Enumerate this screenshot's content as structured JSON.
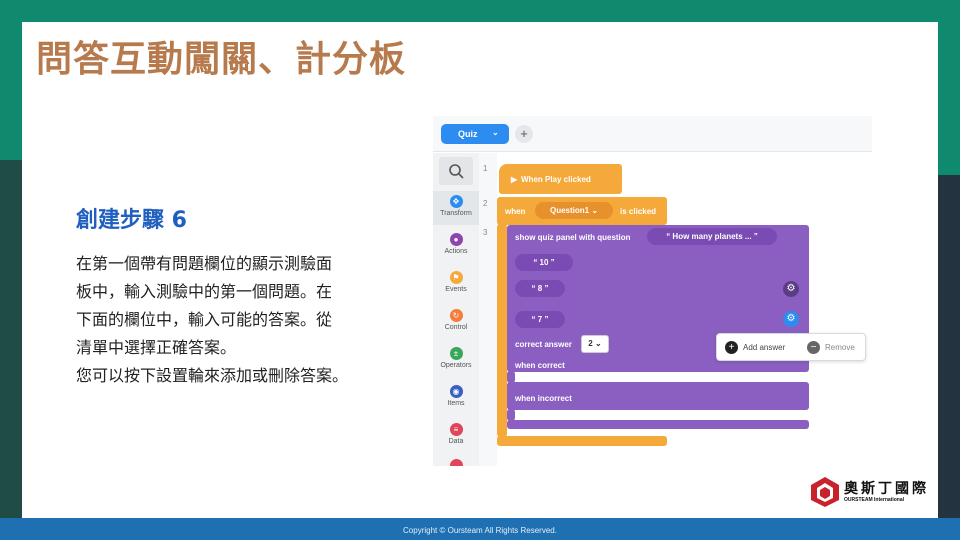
{
  "slide": {
    "title": "問答互動闖關、計分板",
    "step_title": "創建步驟 6",
    "description_lines": [
      "在第一個帶有問題欄位的顯示測驗面",
      "板中，輸入測驗中的第一個問題。在",
      "下面的欄位中，輸入可能的答案。從",
      "清單中選擇正確答案。",
      "您可以按下設置輪來添加或刪除答案。"
    ],
    "footer": "Copyright © Oursteam All Rights Reserved.",
    "logo": {
      "chinese": "奧斯丁國際",
      "english": "OURSTEAM International"
    }
  },
  "colors": {
    "accent_green": "#0f8a6e",
    "title_brown": "#b67a4d",
    "step_blue": "#1f5fbf",
    "footer_blue": "#1f6fb3",
    "block_orange": "#f5a93a",
    "block_purple": "#8b5fc2",
    "tab_blue": "#2d8cf0"
  },
  "editor": {
    "tab_label": "Quiz",
    "add_tab_symbol": "+",
    "palette": [
      {
        "label": "Transform",
        "icon": "transform-icon",
        "color": "#2d8cf0"
      },
      {
        "label": "Actions",
        "icon": "eye-icon",
        "color": "#8e44ad"
      },
      {
        "label": "Events",
        "icon": "flag-icon",
        "color": "#f5a93a"
      },
      {
        "label": "Control",
        "icon": "control-icon",
        "color": "#f57c3a"
      },
      {
        "label": "Operators",
        "icon": "operators-icon",
        "color": "#3aa65a"
      },
      {
        "label": "Items",
        "icon": "items-icon",
        "color": "#3a5fc2"
      },
      {
        "label": "Data",
        "icon": "data-icon",
        "color": "#e0455a"
      }
    ],
    "line_numbers": [
      "1",
      "2",
      "3"
    ],
    "blocks": {
      "event_label": "When Play clicked",
      "when_label": "when",
      "object_name": "Question1",
      "is_clicked_label": "is clicked",
      "show_quiz_label": "show quiz panel with question",
      "question_text": "How many planets ...",
      "answers": [
        "10",
        "8",
        "7"
      ],
      "correct_answer_label": "correct answer",
      "correct_answer_value": "2",
      "when_correct_label": "when correct",
      "when_incorrect_label": "when incorrect"
    },
    "popup": {
      "add_label": "Add answer",
      "remove_label": "Remove"
    }
  }
}
